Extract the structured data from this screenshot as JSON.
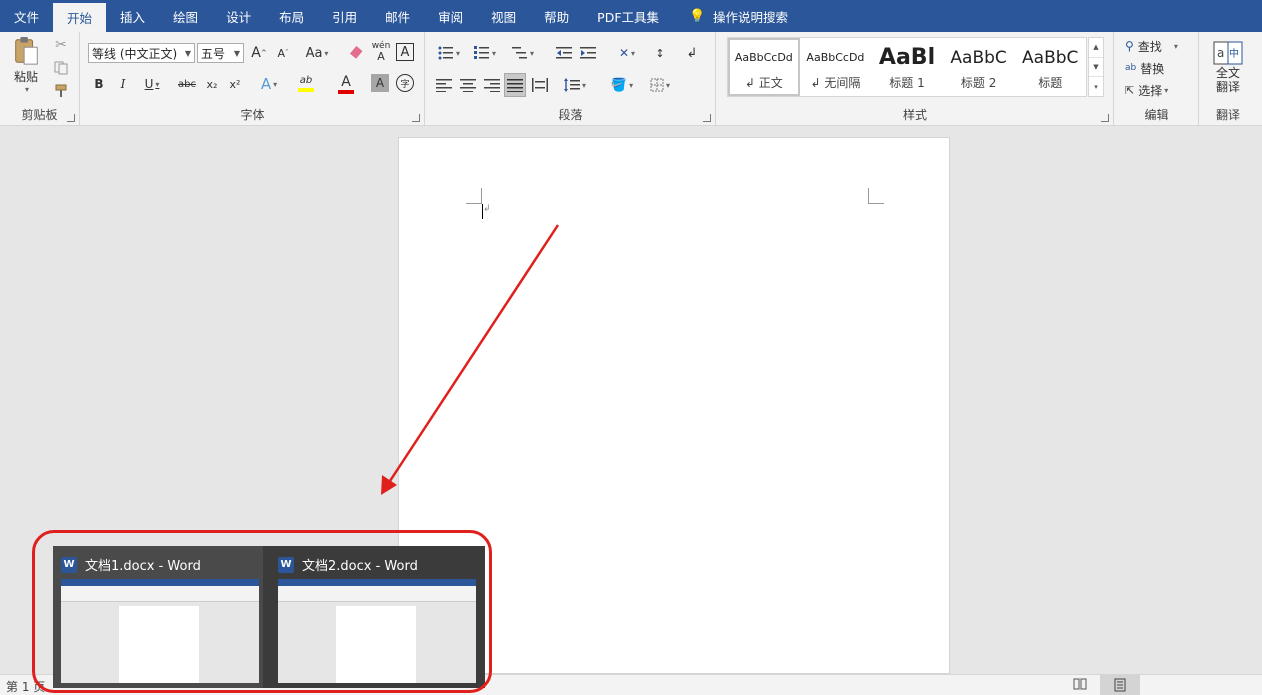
{
  "tabs": [
    {
      "label": "文件",
      "name": "tab-file"
    },
    {
      "label": "开始",
      "name": "tab-home",
      "active": true
    },
    {
      "label": "插入",
      "name": "tab-insert"
    },
    {
      "label": "绘图",
      "name": "tab-draw"
    },
    {
      "label": "设计",
      "name": "tab-design"
    },
    {
      "label": "布局",
      "name": "tab-layout"
    },
    {
      "label": "引用",
      "name": "tab-references"
    },
    {
      "label": "邮件",
      "name": "tab-mailings"
    },
    {
      "label": "审阅",
      "name": "tab-review"
    },
    {
      "label": "视图",
      "name": "tab-view"
    },
    {
      "label": "帮助",
      "name": "tab-help"
    },
    {
      "label": "PDF工具集",
      "name": "tab-pdf-tools"
    }
  ],
  "tell_me": {
    "label": "操作说明搜索",
    "icon": "lightbulb-icon"
  },
  "clipboard": {
    "group_label": "剪贴板",
    "paste_label": "粘贴"
  },
  "font": {
    "group_label": "字体",
    "font_name": "等线 (中文正文)",
    "font_size": "五号",
    "grow_label": "A",
    "shrink_label": "A",
    "case_label": "Aa",
    "phonetic_label": "wén",
    "border_label": "A",
    "bold": "B",
    "italic": "I",
    "underline": "U",
    "strike": "abc",
    "subscript": "x₂",
    "superscript": "x²",
    "effects": "A",
    "font_color": "A",
    "shading": "A",
    "enclose": "字",
    "highlight_label": "ab"
  },
  "paragraph": {
    "group_label": "段落"
  },
  "styles": {
    "group_label": "样式",
    "items": [
      {
        "sample": "AaBbCcDd",
        "name": "↲ 正文"
      },
      {
        "sample": "AaBbCcDd",
        "name": "↲ 无间隔"
      },
      {
        "sample": "AaBl",
        "name": "标题 1"
      },
      {
        "sample": "AaBbC",
        "name": "标题 2"
      },
      {
        "sample": "AaBbC",
        "name": "标题"
      }
    ]
  },
  "editing": {
    "group_label": "编辑",
    "find": "查找",
    "replace": "替换",
    "select": "选择"
  },
  "translate": {
    "group_label": "翻译",
    "line1": "全文",
    "line2": "翻译"
  },
  "document": {
    "paragraph_mark": "↲"
  },
  "status": {
    "page": "第 1 页"
  },
  "thumbnails": [
    {
      "title": "文档1.docx - Word"
    },
    {
      "title": "文档2.docx - Word"
    }
  ],
  "colors": {
    "accent": "#2b579a",
    "annotation": "#e0201c",
    "font_color_bar": "#e00000",
    "highlight_bar": "#ffff00"
  }
}
